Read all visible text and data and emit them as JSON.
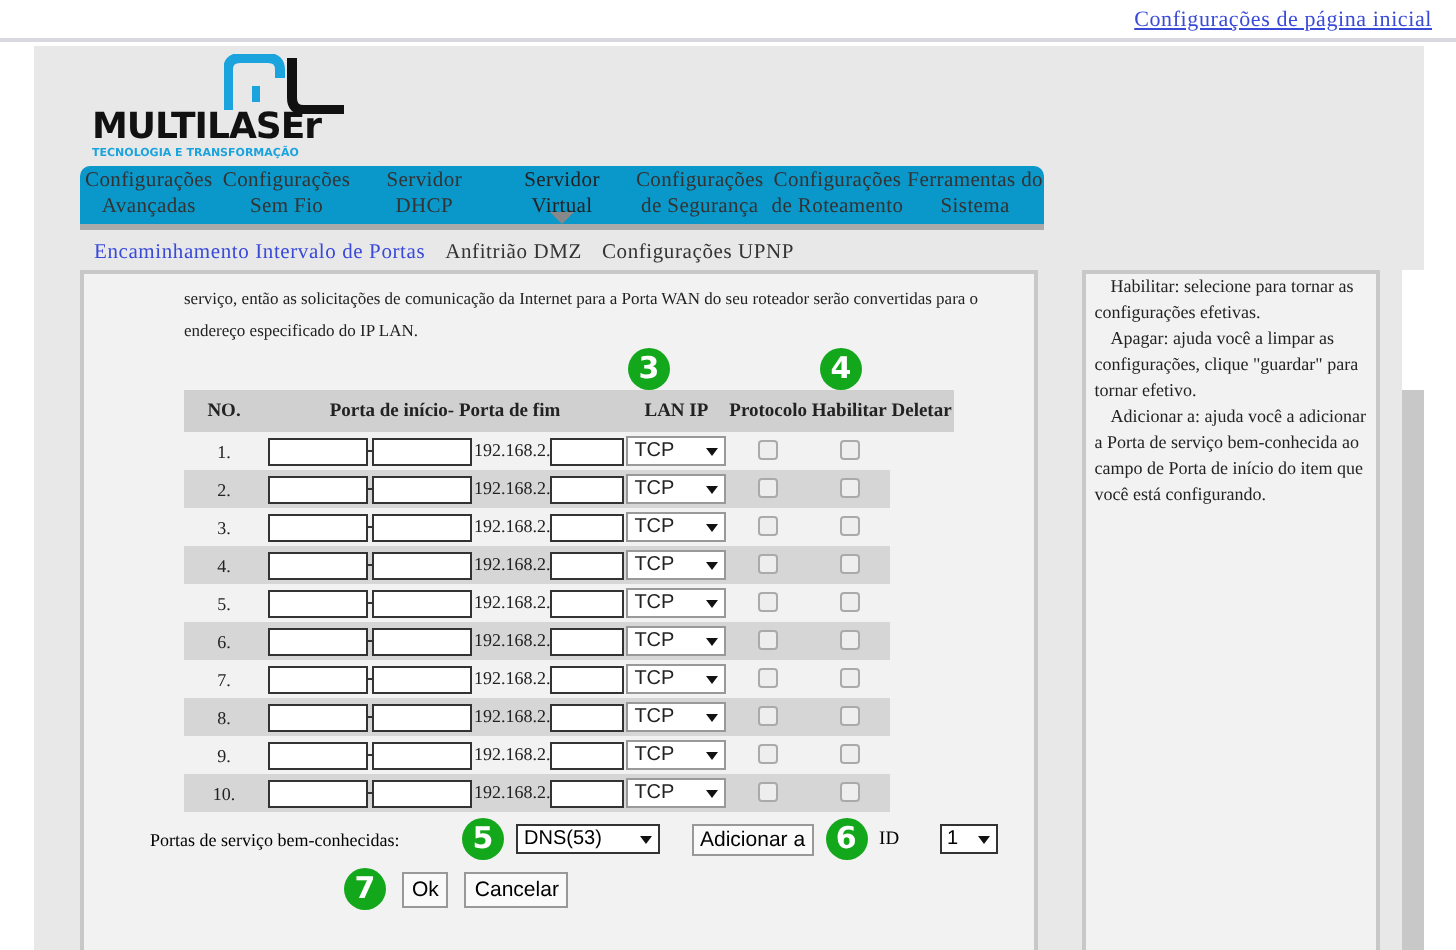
{
  "top_link": "Configurações de página inicial",
  "logo": {
    "name": "MULTILASEr",
    "tagline": "TECNOLOGIA E TRANSFORMAÇÃO"
  },
  "nav": [
    {
      "label": "Configurações Avançadas",
      "selected": false
    },
    {
      "label": "Configurações Sem Fio",
      "selected": false
    },
    {
      "label": "Servidor DHCP",
      "selected": false
    },
    {
      "label": "Servidor Virtual",
      "selected": true
    },
    {
      "label": "Configurações de Segurança",
      "selected": false
    },
    {
      "label": "Configurações de Roteamento",
      "selected": false
    },
    {
      "label": "Ferramentas do Sistema",
      "selected": false
    }
  ],
  "subtabs": [
    {
      "label": "Encaminhamento Intervalo de Portas",
      "selected": true
    },
    {
      "label": "Anfitrião DMZ",
      "selected": false
    },
    {
      "label": "Configurações UPNP",
      "selected": false
    }
  ],
  "intro": "serviço, então as solicitações de comunicação da Internet para a Porta WAN do seu roteador serão convertidas para o endereço especificado do IP LAN.",
  "table": {
    "columns": [
      "NO.",
      "Porta de início- Porta de fim",
      "LAN IP",
      "Protocolo",
      "Habilitar",
      "Deletar"
    ],
    "rows": [
      {
        "no": "1.",
        "ip_prefix": "192.168.2.",
        "protocol": "TCP",
        "enabled": false,
        "delete": false
      },
      {
        "no": "2.",
        "ip_prefix": "192.168.2.",
        "protocol": "TCP",
        "enabled": false,
        "delete": false
      },
      {
        "no": "3.",
        "ip_prefix": "192.168.2.",
        "protocol": "TCP",
        "enabled": false,
        "delete": false
      },
      {
        "no": "4.",
        "ip_prefix": "192.168.2.",
        "protocol": "TCP",
        "enabled": false,
        "delete": false
      },
      {
        "no": "5.",
        "ip_prefix": "192.168.2.",
        "protocol": "TCP",
        "enabled": false,
        "delete": false
      },
      {
        "no": "6.",
        "ip_prefix": "192.168.2.",
        "protocol": "TCP",
        "enabled": false,
        "delete": false
      },
      {
        "no": "7.",
        "ip_prefix": "192.168.2.",
        "protocol": "TCP",
        "enabled": false,
        "delete": false
      },
      {
        "no": "8.",
        "ip_prefix": "192.168.2.",
        "protocol": "TCP",
        "enabled": false,
        "delete": false
      },
      {
        "no": "9.",
        "ip_prefix": "192.168.2.",
        "protocol": "TCP",
        "enabled": false,
        "delete": false
      },
      {
        "no": "10.",
        "ip_prefix": "192.168.2.",
        "protocol": "TCP",
        "enabled": false,
        "delete": false
      }
    ]
  },
  "well_known": {
    "label": "Portas de serviço bem-conhecidas:",
    "value": "DNS(53)",
    "add_button": "Adicionar a",
    "id_label": "ID",
    "id_value": "1"
  },
  "buttons": [
    "Ok",
    "Cancelar"
  ],
  "help": [
    "Habilitar: selecione para tornar as configurações efetivas.",
    "Apagar: ajuda você a limpar as configurações, clique \"guardar\" para tornar efetivo.",
    "Adicionar a: ajuda você a adicionar a Porta de serviço bem-conhecida ao campo de Porta de início do item que você está configurando."
  ],
  "badges": [
    "3",
    "4",
    "5",
    "6",
    "7"
  ]
}
